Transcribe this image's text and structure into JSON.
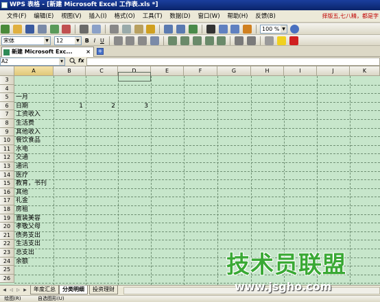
{
  "window": {
    "title": "WPS 表格 - [新建 Microsoft Excel 工作表.xls *]"
  },
  "menu": {
    "items": [
      "文件(F)",
      "编辑(E)",
      "视图(V)",
      "插入(I)",
      "格式(O)",
      "工具(T)",
      "数据(D)",
      "窗口(W)",
      "帮助(H)",
      "反馈(B)"
    ],
    "promo": "择版五,七八精，都是字"
  },
  "toolbar": {
    "zoom": "100 %"
  },
  "format_toolbar": {
    "font": "宋体",
    "size": "12",
    "bold": "B",
    "italic": "I",
    "underline": "U"
  },
  "tabs": {
    "doc_label": "新建 Microsoft Exc...",
    "close": "×",
    "new_tab": "+"
  },
  "formula_bar": {
    "cell_ref": "A2",
    "fx": "fx"
  },
  "sheet": {
    "columns": [
      "A",
      "B",
      "C",
      "D",
      "E",
      "F",
      "G",
      "H",
      "I",
      "J",
      "K"
    ],
    "row_numbers": [
      "3",
      "4",
      "5",
      "6",
      "7",
      "8",
      "9",
      "10",
      "11",
      "12",
      "13",
      "14",
      "15",
      "16",
      "17",
      "18",
      "19",
      "20",
      "21",
      "22",
      "23",
      "24",
      "25",
      "26"
    ],
    "col_a": [
      "",
      "",
      "一月",
      "日期",
      "工资收入",
      "生活费",
      "其他收入",
      "餐饮食品",
      "水电",
      "交通",
      "通讯",
      "医疗",
      "教育，书刊",
      "其他",
      "礼金",
      "房租",
      "置装美容",
      "孝敬父母",
      "债务支出",
      "生活支出",
      "总支出",
      "余额",
      "",
      ""
    ],
    "row6_values": {
      "B": "1",
      "C": "2",
      "D": "3"
    }
  },
  "sheet_tabs": {
    "items": [
      "年度汇总",
      "分类明细",
      "投资理财"
    ],
    "active": 1
  },
  "bottom_bar": {
    "label": "自选图形(U)",
    "draw": "绘图(R)"
  },
  "watermark": {
    "title": "技术员联盟",
    "url": "www.jsgho.com"
  },
  "colors": {
    "grid_bg": "#c7e6cb",
    "title_bar": "#0a246a",
    "watermark_green": "#3aa935"
  }
}
